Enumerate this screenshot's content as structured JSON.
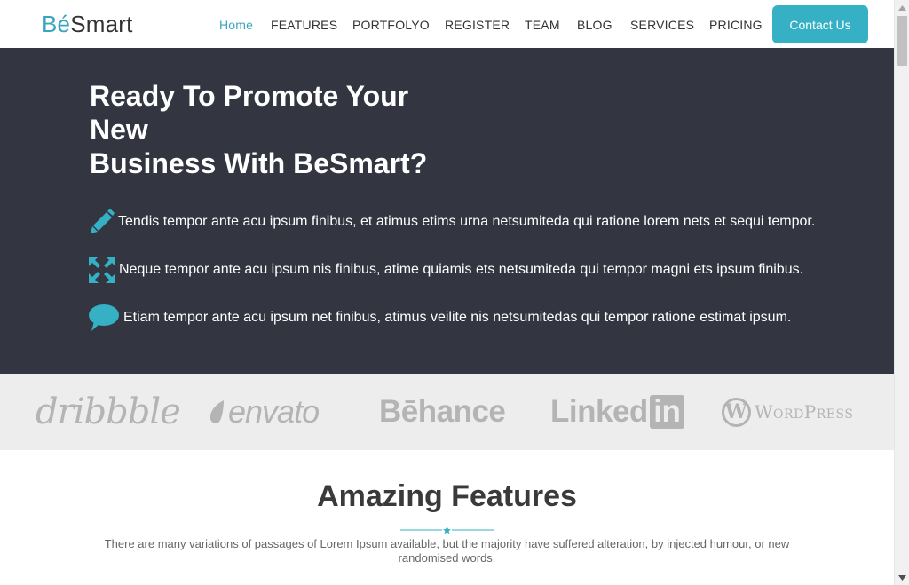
{
  "header": {
    "logo_accent": "Bé",
    "logo_rest": "Smart",
    "nav": [
      {
        "label": "Home",
        "active": true
      },
      {
        "label": "FEATURES"
      },
      {
        "label": "PORTFOLYO"
      },
      {
        "label": "REGISTER"
      },
      {
        "label": "TEAM"
      },
      {
        "label": "BLOG"
      },
      {
        "label": "SERVICES"
      },
      {
        "label": "PRICING"
      }
    ],
    "contact_label": "Contact Us"
  },
  "hero": {
    "title_lines": [
      "Ready To Promote Your",
      "New",
      "Business With BeSmart?"
    ],
    "features": [
      {
        "icon": "pencil-icon",
        "text": "Tendis tempor ante acu ipsum finibus, et atimus etims urna netsumiteda qui ratione lorem nets et sequi tempor."
      },
      {
        "icon": "expand-arrows-icon",
        "text": "Neque tempor ante acu ipsum nis finibus, atime quiamis ets netsumiteda qui tempor magni ets ipsum finibus."
      },
      {
        "icon": "speech-bubble-icon",
        "text": "Etiam tempor ante acu ipsum net finibus, atimus veilite nis netsumitedas qui tempor ratione estimat ipsum."
      }
    ]
  },
  "brands": {
    "dribbble": "dribbble",
    "envato": "envato",
    "behance": "Bēhance",
    "linkedin_text": "Linked",
    "linkedin_box": "in",
    "wordpress_mark": "W",
    "wordpress_text": "WordPress"
  },
  "features_section": {
    "title": "Amazing Features",
    "description": "There are many variations of passages of Lorem Ipsum available, but the majority have suffered alteration, by injected humour, or new randomised words."
  },
  "colors": {
    "accent": "#35b0c5",
    "hero_bg": "#333640",
    "brand_strip_bg": "#ededee",
    "brand_gray": "#b4b4b4"
  }
}
